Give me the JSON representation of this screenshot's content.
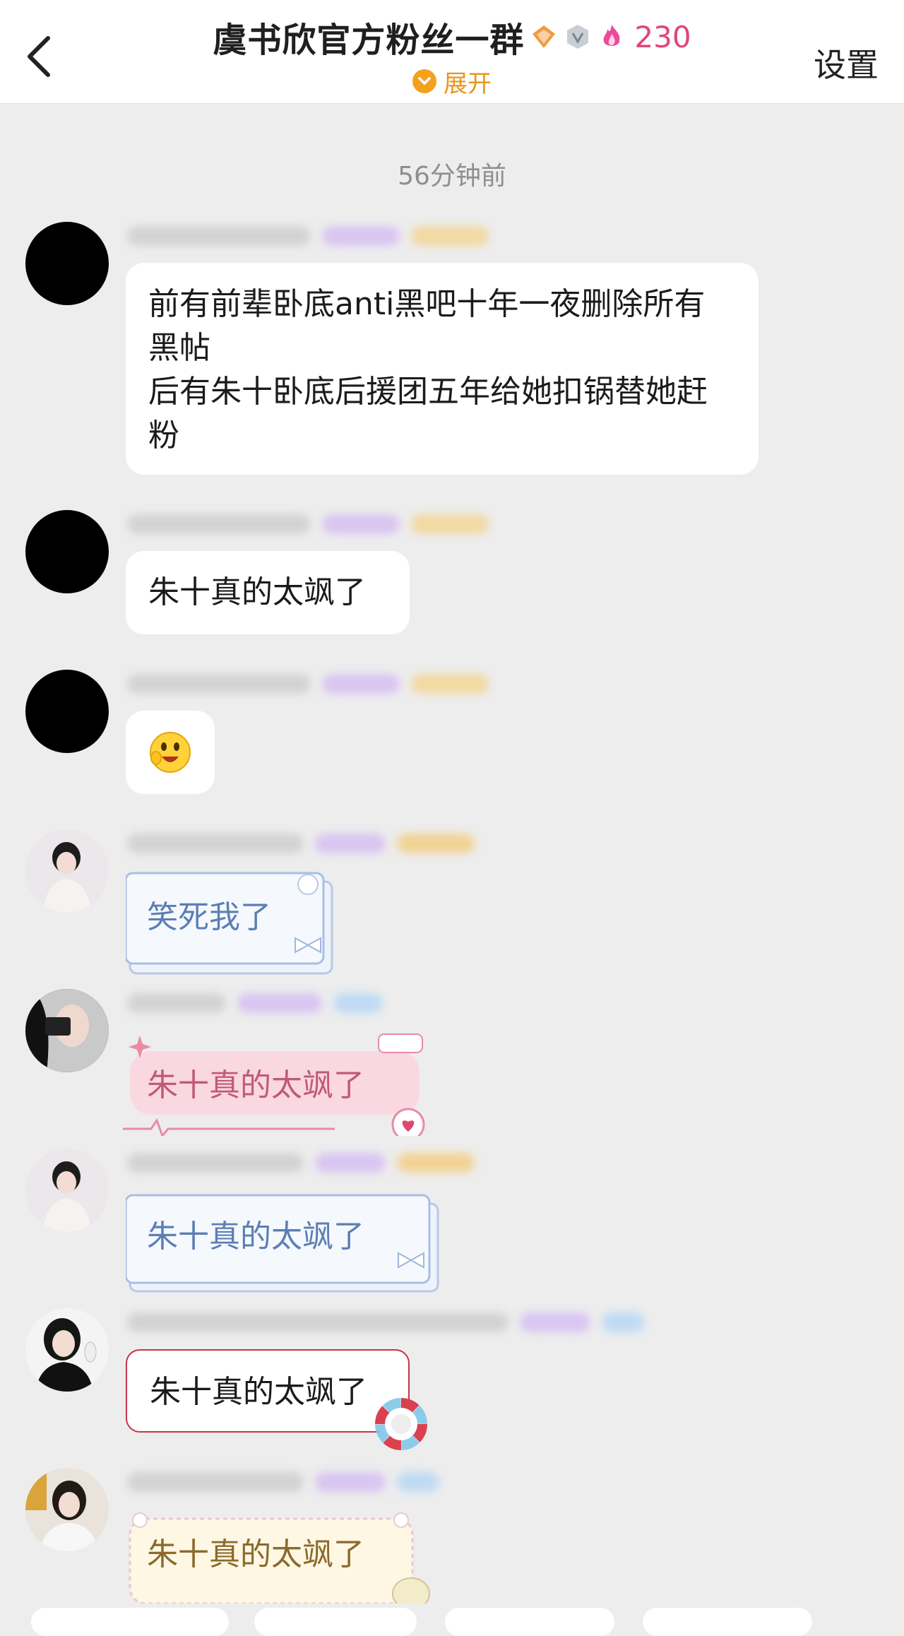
{
  "header": {
    "title": "虞书欣官方粉丝一群",
    "member_count": "230",
    "expand_label": "展开",
    "settings_label": "设置",
    "badges": [
      "orange-diamond-badge-icon",
      "silver-v-badge-icon",
      "flame-badge-icon"
    ]
  },
  "timestamp": "56分钟前",
  "messages": [
    {
      "text": "前有前辈卧底anti黑吧十年一夜删除所有黑帖\n后有朱十卧底后援团五年给她扣锅替她赶粉"
    },
    {
      "text": "朱十真的太飒了"
    },
    {
      "text": ""
    },
    {
      "text": "笑死我了"
    },
    {
      "text": "朱十真的太飒了"
    },
    {
      "text": "朱十真的太飒了"
    },
    {
      "text": "朱十真的太飒了"
    },
    {
      "text": "朱十真的太飒了"
    }
  ],
  "colors": {
    "accent_pink": "#e0457b",
    "expand_orange": "#e8961a",
    "background": "#ededed"
  }
}
